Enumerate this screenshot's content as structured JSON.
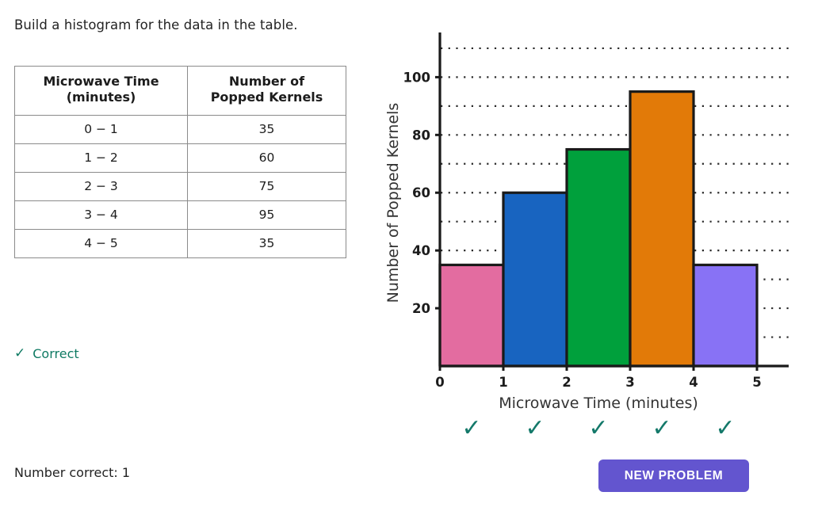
{
  "prompt": "Build a histogram for the data in the table.",
  "table": {
    "headers": [
      "Microwave Time (minutes)",
      "Number of Popped Kernels"
    ],
    "header_lines": [
      [
        "Microwave Time",
        "(minutes)"
      ],
      [
        "Number of",
        "Popped Kernels"
      ]
    ],
    "rows": [
      {
        "interval": "0 − 1",
        "count": "35"
      },
      {
        "interval": "1 − 2",
        "count": "60"
      },
      {
        "interval": "2 − 3",
        "count": "75"
      },
      {
        "interval": "3 − 4",
        "count": "95"
      },
      {
        "interval": "4 − 5",
        "count": "35"
      }
    ]
  },
  "feedback": {
    "icon": "check-icon",
    "label": "Correct",
    "color": "#0f7a63"
  },
  "score": {
    "label": "Number correct: 1"
  },
  "bar_checks": {
    "glyph": "✓",
    "color": "#14796a",
    "count": 5
  },
  "button": {
    "label": "NEW PROBLEM",
    "color": "#6355cf",
    "text_color": "#ffffff"
  },
  "chart_data": {
    "type": "bar",
    "title": "",
    "xlabel": "Microwave Time (minutes)",
    "ylabel": "Number of Popped Kernels",
    "categories": [
      "0 − 1",
      "1 − 2",
      "2 − 3",
      "3 − 4",
      "4 − 5"
    ],
    "bin_edges": [
      0,
      1,
      2,
      3,
      4,
      5
    ],
    "values": [
      35,
      60,
      75,
      95,
      35
    ],
    "bar_colors": [
      "#e36ca0",
      "#1864c0",
      "#00a03c",
      "#e27a08",
      "#8872f5"
    ],
    "bar_edge_color": "#1a1a1a",
    "xlim": [
      0,
      5.55
    ],
    "ylim": [
      0,
      113
    ],
    "xticks": [
      0,
      1,
      2,
      3,
      4,
      5
    ],
    "xtick_labels": [
      "0",
      "1",
      "2",
      "3",
      "4",
      "5"
    ],
    "yticks": [
      20,
      40,
      60,
      80,
      100
    ],
    "ytick_labels": [
      "20",
      "40",
      "60",
      "80",
      "100"
    ],
    "gridlines_y": [
      10,
      20,
      30,
      40,
      50,
      60,
      70,
      80,
      90,
      100,
      110
    ],
    "grid": "dotted-horizontal",
    "legend": "none"
  }
}
